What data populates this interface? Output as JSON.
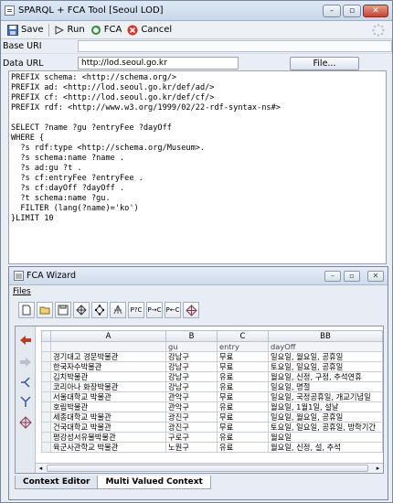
{
  "window": {
    "title": "SPARQL + FCA Tool [Seoul LOD]"
  },
  "toolbar": {
    "save_label": "Save",
    "run_label": "Run",
    "fca_label": "FCA",
    "cancel_label": "Cancel"
  },
  "fields": {
    "base_uri_label": "Base URI",
    "base_uri_value": "",
    "data_url_label": "Data URL",
    "data_url_value": "http://lod.seoul.go.kr",
    "file_button": "File..."
  },
  "query_lines": [
    "PREFIX schema: <http://schema.org/>",
    "PREFIX ad: <http://lod.seoul.go.kr/def/ad/>",
    "PREFIX cf: <http://lod.seoul.go.kr/def/cf/>",
    "PREFIX rdf: <http://www.w3.org/1999/02/22-rdf-syntax-ns#>",
    "",
    "SELECT ?name ?gu ?entryFee ?dayOff",
    "WHERE {",
    "  ?s rdf:type <http://schema.org/Museum>.",
    "  ?s schema:name ?name .",
    "  ?s ad:gu ?t .",
    "  ?s cf:entryFee ?entryFee .",
    "  ?s cf:dayOff ?dayOff .",
    "  ?t schema:name ?gu.",
    "  FILTER (lang(?name)='ko')",
    "}LIMIT 10"
  ],
  "fca": {
    "title": "FCA Wizard",
    "menu_files": "Files",
    "tools": [
      "new-doc",
      "open-folder",
      "save",
      "lattice-a",
      "lattice-b",
      "lattice-c",
      "P?C",
      "P→C",
      "P←C",
      "diamond"
    ],
    "columns": [
      "A",
      "B",
      "C",
      "BB"
    ],
    "subheader": [
      "",
      "gu",
      "entry",
      "dayOff"
    ],
    "rows": [
      [
        "경기대고 경문박물관",
        "강남구",
        "무료",
        "일요일, 월요일, 공휴일"
      ],
      [
        "한국자수박물관",
        "강남구",
        "무료",
        "토요일, 일요일, 공휴일"
      ],
      [
        "김치박물관",
        "강남구",
        "유료",
        "월요일, 신정, 구정, 추석연휴"
      ],
      [
        "코리아나 화장박물관",
        "강남구",
        "유료",
        "일요일, 명절"
      ],
      [
        "서울대학교 박물관",
        "관악구",
        "무료",
        "일요일, 국정공휴일, 개교기념일"
      ],
      [
        "호림박물관",
        "관악구",
        "유료",
        "월요일, 1월1일, 설날"
      ],
      [
        "세종대학교 박물관",
        "광진구",
        "무료",
        "일요일, 월요일, 공휴일"
      ],
      [
        "건국대학교 박물관",
        "광진구",
        "무료",
        "토요일, 일요일, 공휴일, 방학기간"
      ],
      [
        "평강성서유물박물관",
        "구로구",
        "유료",
        "월요일"
      ],
      [
        "육군사관학교 박물관",
        "노원구",
        "유료",
        "월요일, 신정, 설, 추석"
      ]
    ],
    "tabs": [
      "Context Editor",
      "Multi Valued Context"
    ]
  }
}
